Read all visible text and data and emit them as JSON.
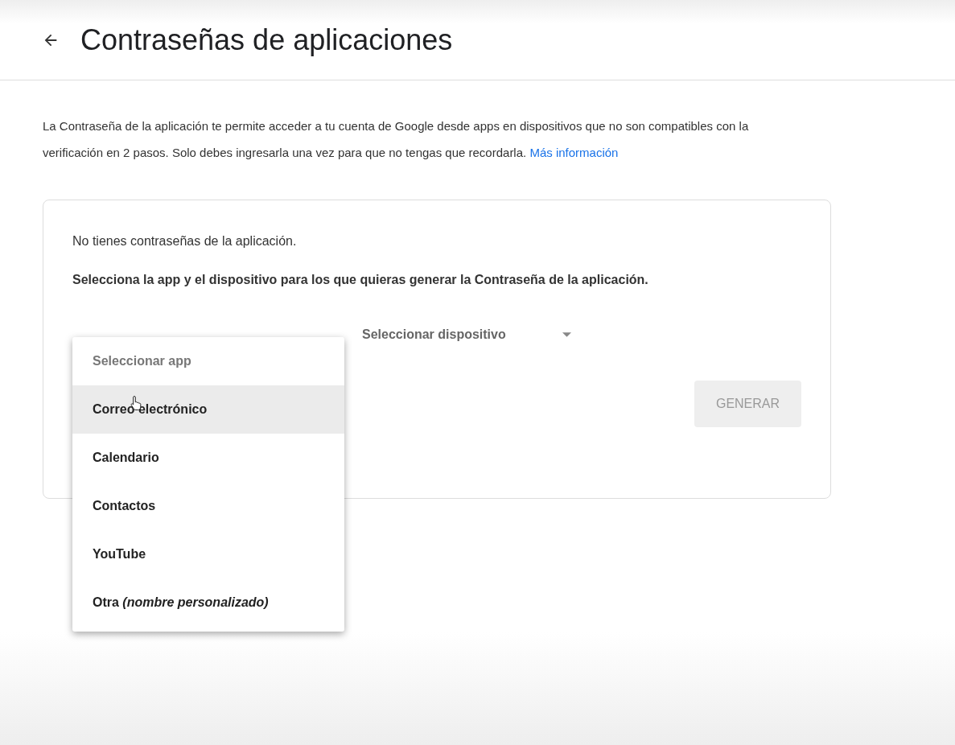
{
  "header": {
    "title": "Contraseñas de aplicaciones"
  },
  "intro": {
    "text": "La Contraseña de la aplicación te permite acceder a tu cuenta de Google desde apps en dispositivos que no son compatibles con la verificación en 2 pasos. Solo debes ingresarla una vez para que no tengas que recordarla.",
    "link": "Más información"
  },
  "card": {
    "empty_text": "No tienes contraseñas de la aplicación.",
    "instruction": "Selecciona la app y el dispositivo para los que quieras generar la Contraseña de la aplicación.",
    "device_select": {
      "placeholder": "Seleccionar dispositivo"
    },
    "generate_button": {
      "label": "GENERAR",
      "disabled": true
    }
  },
  "app_menu": {
    "placeholder": "Seleccionar app",
    "items": [
      {
        "label": "Correo electrónico",
        "selected": true
      },
      {
        "label": "Calendario",
        "selected": false
      },
      {
        "label": "Contactos",
        "selected": false
      },
      {
        "label": "YouTube",
        "selected": false
      },
      {
        "label": "Otra *(nombre personalizado)*",
        "selected": false
      }
    ]
  }
}
